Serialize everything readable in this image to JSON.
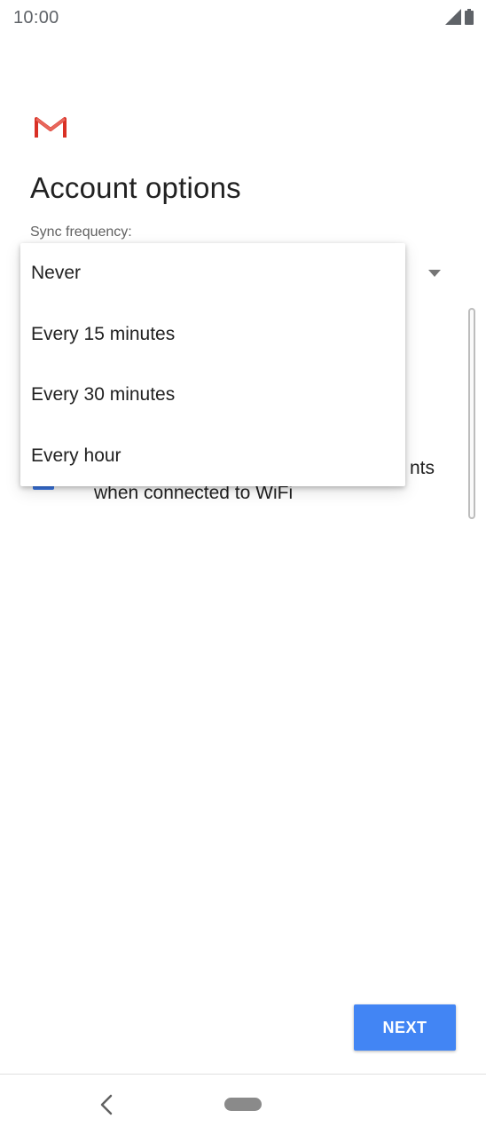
{
  "status_bar": {
    "time": "10:00",
    "icons": [
      "signal-icon",
      "battery-icon"
    ]
  },
  "logo": {
    "icon": "gmail-logo",
    "color": "#d93025"
  },
  "page": {
    "title": "Account options",
    "sync_label": "Sync frequency:"
  },
  "sync_menu": {
    "options": [
      "Never",
      "Every 15 minutes",
      "Every 30 minutes",
      "Every hour"
    ]
  },
  "checkbox_row": {
    "label_line1_visible": "nts",
    "label_line2": "when connected to WiFi",
    "checked": true,
    "color": "#3b78e7"
  },
  "buttons": {
    "next_label": "NEXT",
    "color": "#4285f4"
  },
  "nav_bar": {
    "icons": [
      "back-icon",
      "home-pill"
    ]
  }
}
